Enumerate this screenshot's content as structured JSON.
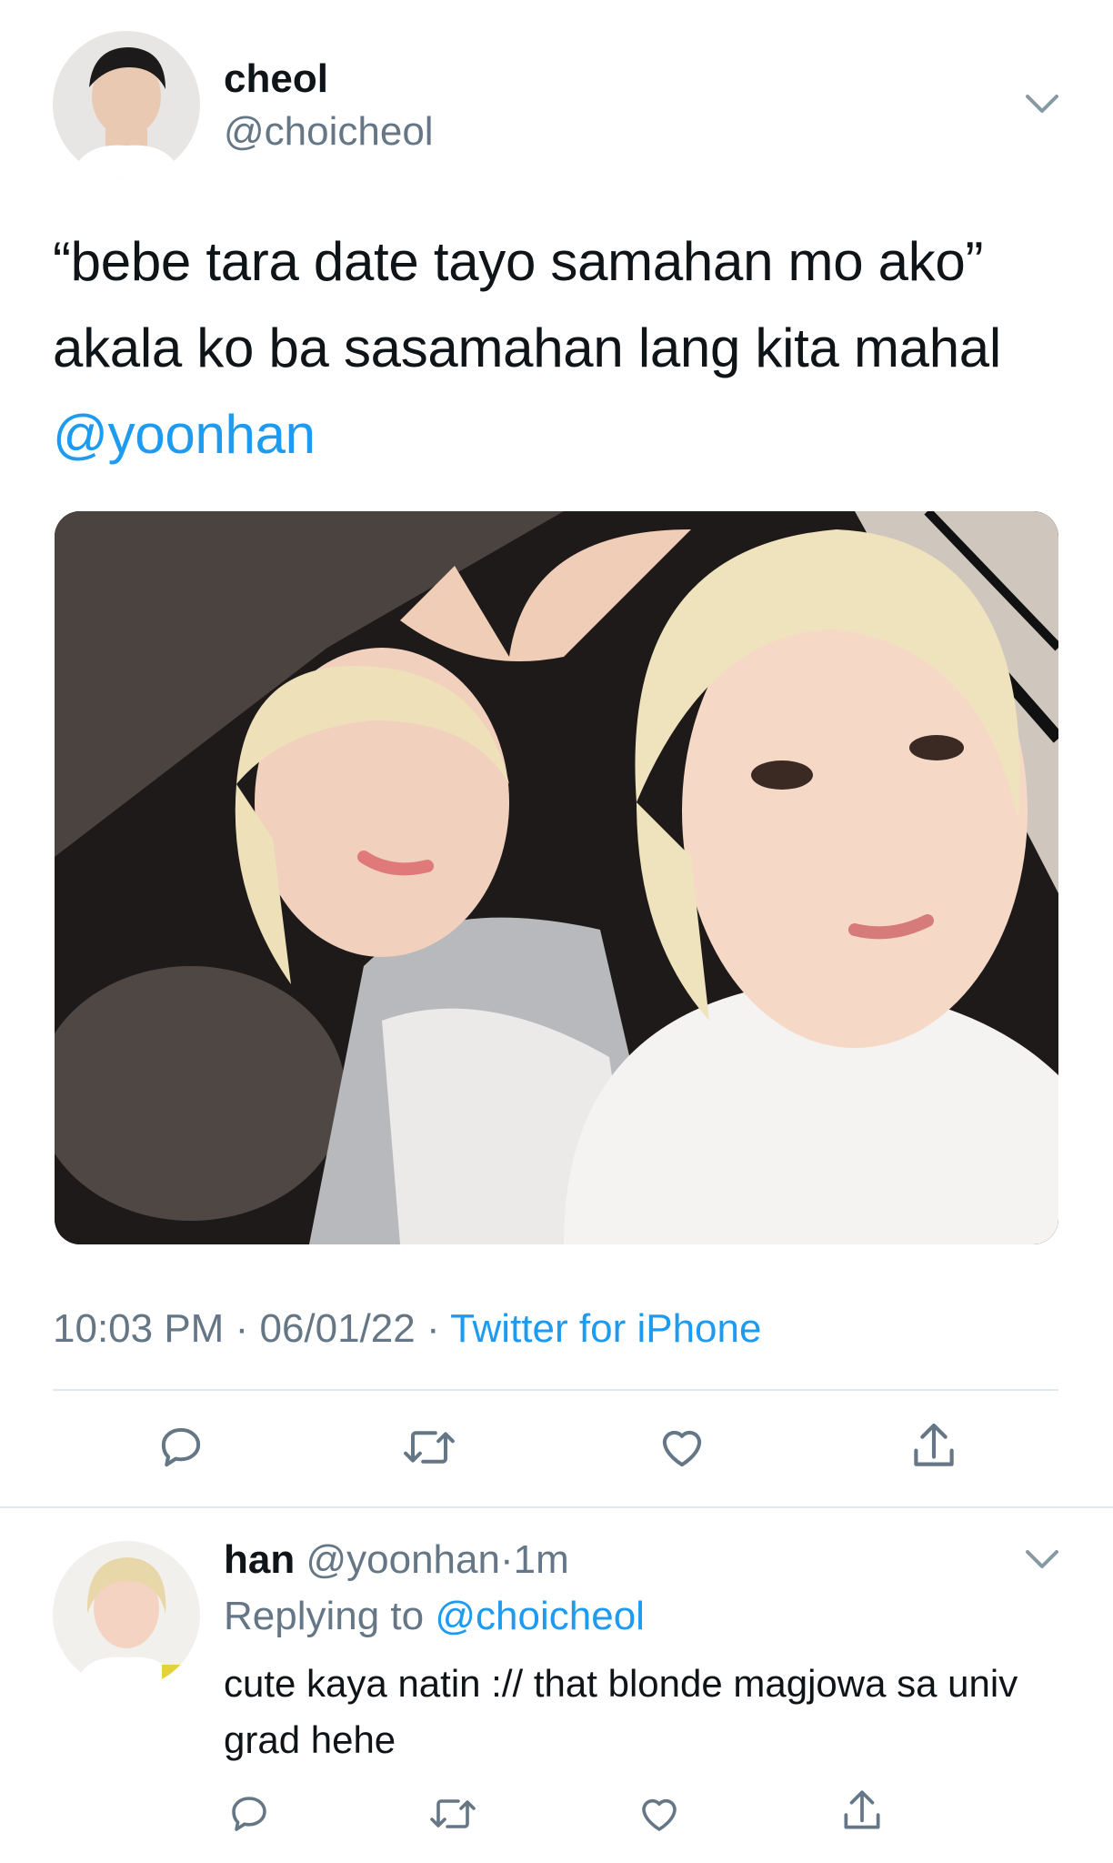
{
  "tweet": {
    "author_name": "cheol",
    "author_handle": "@choicheol",
    "text_before_mention": "“bebe tara date tayo samahan mo ako” akala ko ba sasamahan lang kita mahal",
    "mention": "@yoonhan",
    "timestamp": "10:03 PM",
    "date": "06/01/22",
    "source": "Twitter for iPhone",
    "sep": "·"
  },
  "reply": {
    "author_name": "han",
    "author_handle": "@yoonhan",
    "sep": "·",
    "age": "1m",
    "replying_to_label": "Replying to",
    "replying_to_handle": "@choicheol",
    "text": "cute kaya natin :// that blonde magjowa sa univ grad hehe"
  },
  "icons": [
    "chevron-down-icon",
    "reply-icon",
    "retweet-icon",
    "like-icon",
    "share-icon"
  ],
  "colors": {
    "link": "#1d9bf0",
    "secondary": "#657786",
    "divider": "#e1e8ed"
  }
}
